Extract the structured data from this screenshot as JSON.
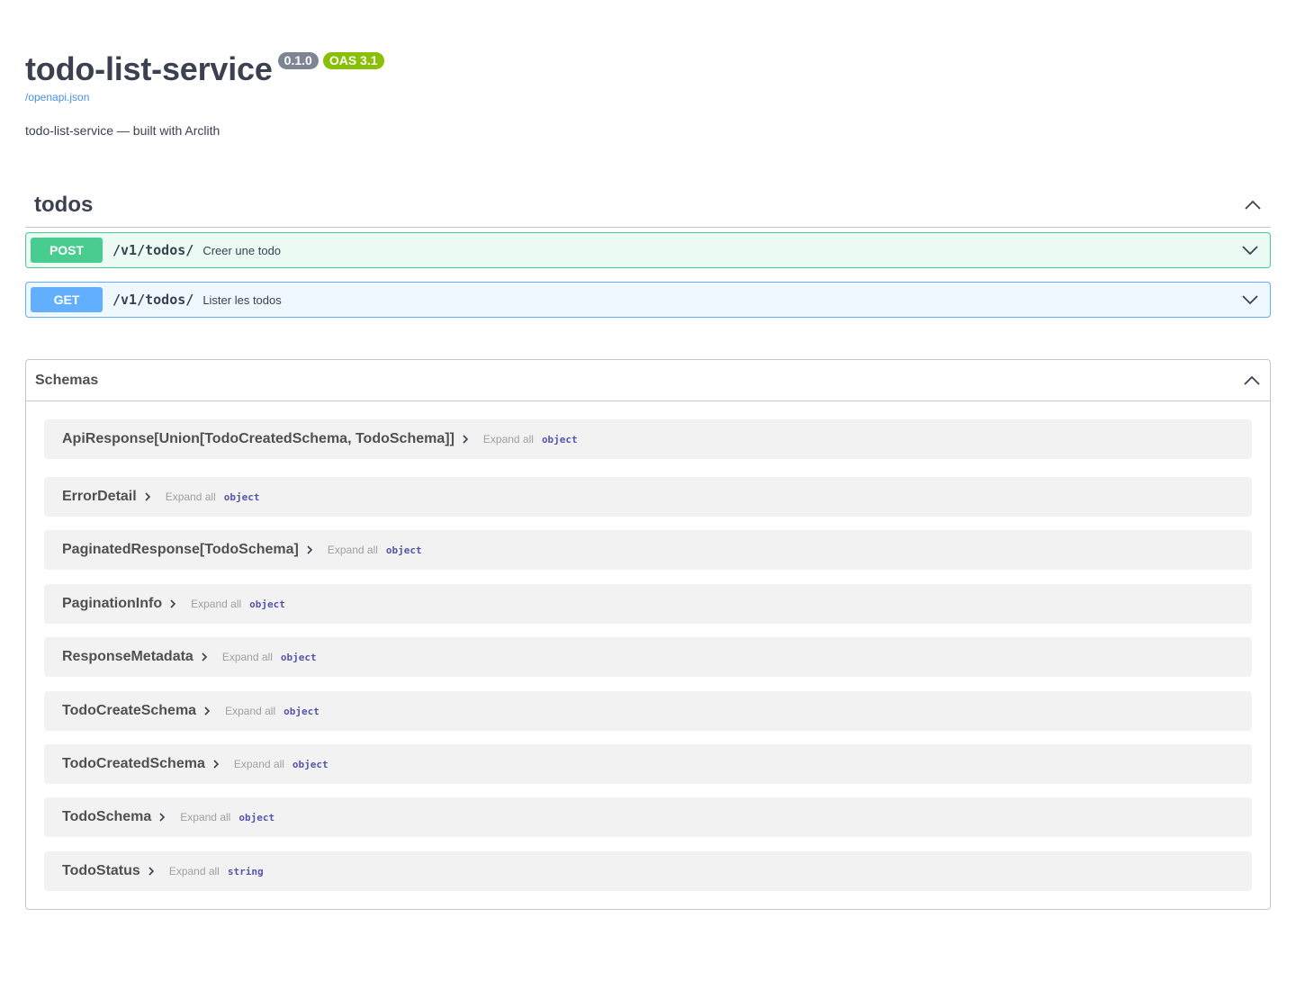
{
  "info": {
    "title": "todo-list-service",
    "version": "0.1.0",
    "oas": "OAS 3.1",
    "spec_link": "/openapi.json",
    "description": "todo-list-service — built with Arclith"
  },
  "tag": {
    "name": "todos",
    "operations": [
      {
        "method": "POST",
        "path": "/v1/todos/",
        "summary": "Creer une todo"
      },
      {
        "method": "GET",
        "path": "/v1/todos/",
        "summary": "Lister les todos"
      }
    ]
  },
  "schemas": {
    "title": "Schemas",
    "expand_label": "Expand all",
    "items": [
      {
        "name": "ApiResponse[Union[TodoCreatedSchema, TodoSchema]]",
        "type": "object"
      },
      {
        "name": "ErrorDetail",
        "type": "object"
      },
      {
        "name": "PaginatedResponse[TodoSchema]",
        "type": "object"
      },
      {
        "name": "PaginationInfo",
        "type": "object"
      },
      {
        "name": "ResponseMetadata",
        "type": "object"
      },
      {
        "name": "TodoCreateSchema",
        "type": "object"
      },
      {
        "name": "TodoCreatedSchema",
        "type": "object"
      },
      {
        "name": "TodoSchema",
        "type": "object"
      },
      {
        "name": "TodoStatus",
        "type": "string"
      }
    ]
  },
  "colors": {
    "post": "#49cc90",
    "get": "#61affe",
    "version_badge": "#7d8492",
    "oas_badge": "#89bf04",
    "link": "#4990e2"
  },
  "icons": {
    "collapse": "chevron-up-icon",
    "expand": "chevron-down-icon",
    "model_toggle": "chevron-right-icon"
  }
}
